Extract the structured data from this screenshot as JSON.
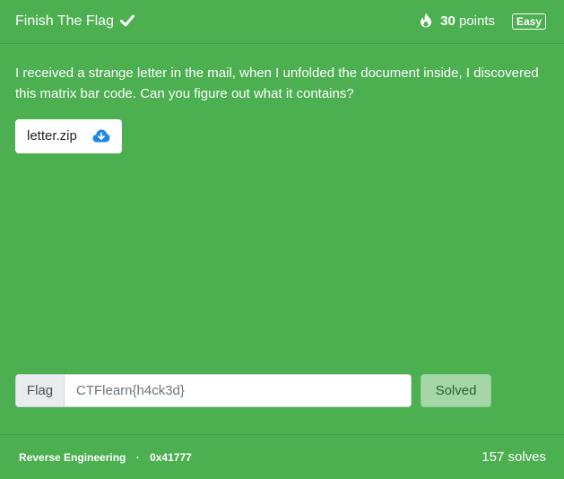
{
  "challenge": {
    "title": "Finish The Flag",
    "points_value": "30",
    "points_label": "points",
    "difficulty": "Easy",
    "description": "I received a strange letter in the mail, when I unfolded the document inside, I discovered this matrix bar code. Can you figure out what it contains?",
    "attachment": "letter.zip"
  },
  "flag_form": {
    "label": "Flag",
    "value": "CTFlearn{h4ck3d}",
    "submit_label": "Solved"
  },
  "footer": {
    "category": "Reverse Engineering",
    "separator": "·",
    "author": "0x41777",
    "solves": "157 solves"
  },
  "icons": {
    "solved": "check-icon",
    "points": "fire-icon",
    "attachment": "cloud-download-icon"
  },
  "colors": {
    "card_background": "#4caf50",
    "download_icon": "#1e88e5",
    "solved_button": "#a5d6a7"
  }
}
